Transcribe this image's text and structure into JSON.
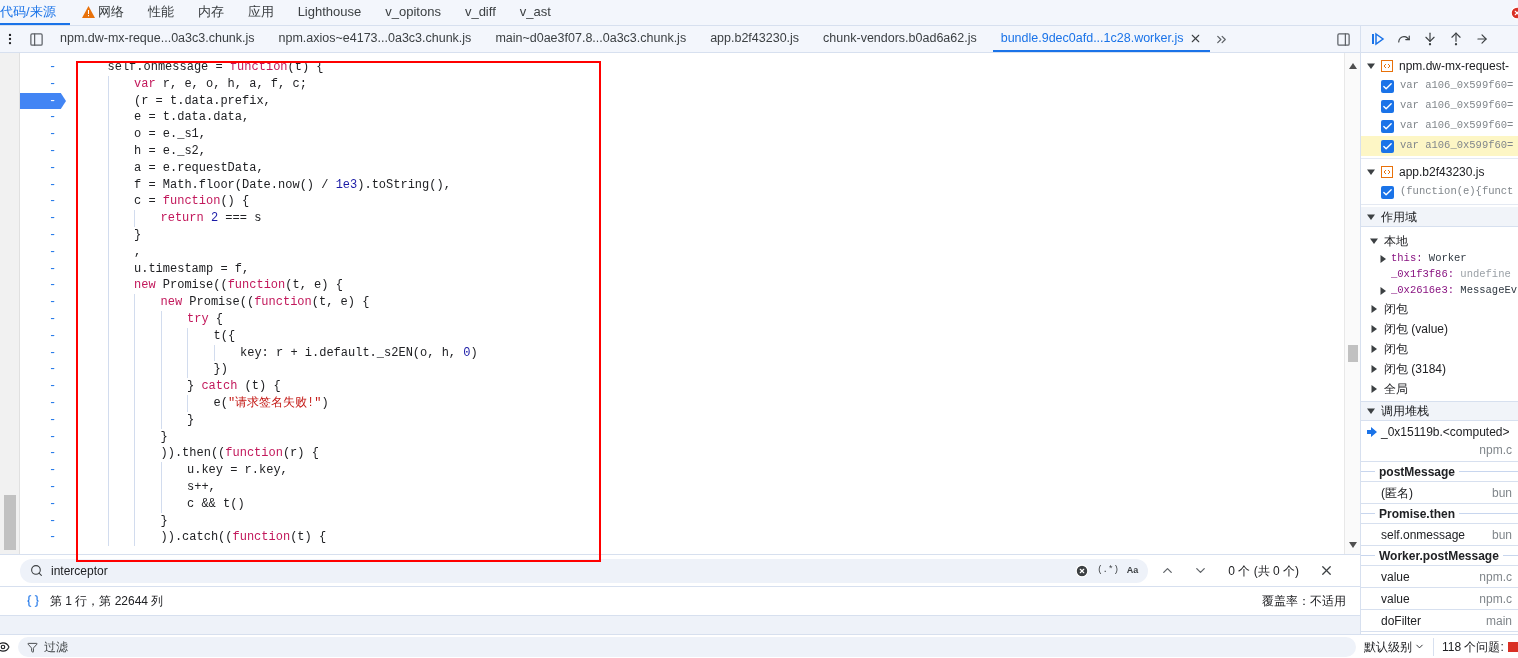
{
  "main_tabs": [
    {
      "label": "代码/来源",
      "selected": true,
      "warning": false
    },
    {
      "label": "网络",
      "selected": false,
      "warning": true
    },
    {
      "label": "性能",
      "selected": false,
      "warning": false
    },
    {
      "label": "内存",
      "selected": false,
      "warning": false
    },
    {
      "label": "应用",
      "selected": false,
      "warning": false
    },
    {
      "label": "Lighthouse",
      "selected": false,
      "warning": false
    },
    {
      "label": "v_opitons",
      "selected": false,
      "warning": false
    },
    {
      "label": "v_diff",
      "selected": false,
      "warning": false
    },
    {
      "label": "v_ast",
      "selected": false,
      "warning": false
    }
  ],
  "file_tabs": [
    {
      "label": "npm.dw-mx-reque...0a3c3.chunk.js",
      "selected": false
    },
    {
      "label": "npm.axios~e4173...0a3c3.chunk.js",
      "selected": false
    },
    {
      "label": "main~d0ae3f07.8...0a3c3.chunk.js",
      "selected": false
    },
    {
      "label": "app.b2f43230.js",
      "selected": false
    },
    {
      "label": "chunk-vendors.b0ad6a62.js",
      "selected": false
    },
    {
      "label": "bundle.9dec0afd...1c28.worker.js",
      "selected": true
    }
  ],
  "code": {
    "lines": [
      {
        "gutter": "-",
        "breakpoint": false,
        "tokens": [
          {
            "t": "self.onmessage = ",
            "kind": "plain"
          },
          {
            "t": "function",
            "kind": "kw"
          },
          {
            "t": "(t) {",
            "kind": "plain"
          }
        ],
        "children": [
          {
            "gutter": "-",
            "breakpoint": false,
            "tokens": [
              {
                "t": "var",
                "kind": "kw"
              },
              {
                "t": " r, e, o, h, a, f, c;",
                "kind": "plain"
              }
            ]
          },
          {
            "gutter": "-",
            "breakpoint": true,
            "tokens": [
              {
                "t": "(r = t.data.prefix,",
                "kind": "plain"
              }
            ]
          },
          {
            "gutter": "-",
            "breakpoint": false,
            "tokens": [
              {
                "t": "e = t.data.data,",
                "kind": "plain"
              }
            ]
          },
          {
            "gutter": "-",
            "breakpoint": false,
            "tokens": [
              {
                "t": "o = e._s1,",
                "kind": "plain"
              }
            ]
          },
          {
            "gutter": "-",
            "breakpoint": false,
            "tokens": [
              {
                "t": "h = e._s2,",
                "kind": "plain"
              }
            ]
          },
          {
            "gutter": "-",
            "breakpoint": false,
            "tokens": [
              {
                "t": "a = e.requestData,",
                "kind": "plain"
              }
            ]
          },
          {
            "gutter": "-",
            "breakpoint": false,
            "tokens": [
              {
                "t": "f = Math.floor(Date.now() / ",
                "kind": "plain"
              },
              {
                "t": "1e3",
                "kind": "num"
              },
              {
                "t": ").toString(),",
                "kind": "plain"
              }
            ]
          },
          {
            "gutter": "-",
            "breakpoint": false,
            "tokens": [
              {
                "t": "c = ",
                "kind": "plain"
              },
              {
                "t": "function",
                "kind": "kw"
              },
              {
                "t": "() {",
                "kind": "plain"
              }
            ],
            "children": [
              {
                "gutter": "-",
                "breakpoint": false,
                "tokens": [
                  {
                    "t": "return",
                    "kind": "kw"
                  },
                  {
                    "t": " 2",
                    "kind": "num"
                  },
                  {
                    "t": " === s",
                    "kind": "plain"
                  }
                ]
              }
            ]
          },
          {
            "gutter": "-",
            "breakpoint": false,
            "tokens": [
              {
                "t": "}",
                "kind": "plain"
              }
            ]
          },
          {
            "gutter": "-",
            "breakpoint": false,
            "tokens": [
              {
                "t": ",",
                "kind": "plain"
              }
            ]
          },
          {
            "gutter": "-",
            "breakpoint": false,
            "tokens": [
              {
                "t": "u.timestamp = f,",
                "kind": "plain"
              }
            ]
          },
          {
            "gutter": "-",
            "breakpoint": false,
            "tokens": [
              {
                "t": "new",
                "kind": "kw"
              },
              {
                "t": " Promise((",
                "kind": "plain"
              },
              {
                "t": "function",
                "kind": "kw"
              },
              {
                "t": "(t, e) {",
                "kind": "plain"
              }
            ],
            "children": [
              {
                "gutter": "-",
                "breakpoint": false,
                "tokens": [
                  {
                    "t": "new",
                    "kind": "kw"
                  },
                  {
                    "t": " Promise((",
                    "kind": "plain"
                  },
                  {
                    "t": "function",
                    "kind": "kw"
                  },
                  {
                    "t": "(t, e) {",
                    "kind": "plain"
                  }
                ],
                "children": [
                  {
                    "gutter": "-",
                    "breakpoint": false,
                    "tokens": [
                      {
                        "t": "try",
                        "kind": "kw"
                      },
                      {
                        "t": " {",
                        "kind": "plain"
                      }
                    ],
                    "children": [
                      {
                        "gutter": "-",
                        "breakpoint": false,
                        "tokens": [
                          {
                            "t": "t({",
                            "kind": "plain"
                          }
                        ],
                        "children": [
                          {
                            "gutter": "-",
                            "breakpoint": false,
                            "tokens": [
                              {
                                "t": "key: r + i.default._s2EN(o, h, ",
                                "kind": "plain"
                              },
                              {
                                "t": "0",
                                "kind": "num"
                              },
                              {
                                "t": ")",
                                "kind": "plain"
                              }
                            ]
                          }
                        ]
                      },
                      {
                        "gutter": "-",
                        "breakpoint": false,
                        "tokens": [
                          {
                            "t": "})",
                            "kind": "plain"
                          }
                        ]
                      }
                    ]
                  },
                  {
                    "gutter": "-",
                    "breakpoint": false,
                    "tokens": [
                      {
                        "t": "} ",
                        "kind": "plain"
                      },
                      {
                        "t": "catch",
                        "kind": "kw"
                      },
                      {
                        "t": " (t) {",
                        "kind": "plain"
                      }
                    ],
                    "children": [
                      {
                        "gutter": "-",
                        "breakpoint": false,
                        "tokens": [
                          {
                            "t": "e(",
                            "kind": "plain"
                          },
                          {
                            "t": "\"请求签名失败!\"",
                            "kind": "str"
                          },
                          {
                            "t": ")",
                            "kind": "plain"
                          }
                        ]
                      }
                    ]
                  },
                  {
                    "gutter": "-",
                    "breakpoint": false,
                    "tokens": [
                      {
                        "t": "}",
                        "kind": "plain"
                      }
                    ]
                  }
                ]
              },
              {
                "gutter": "-",
                "breakpoint": false,
                "tokens": [
                  {
                    "t": "}",
                    "kind": "plain"
                  }
                ]
              },
              {
                "gutter": "-",
                "breakpoint": false,
                "tokens": [
                  {
                    "t": ")).then((",
                    "kind": "plain"
                  },
                  {
                    "t": "function",
                    "kind": "kw"
                  },
                  {
                    "t": "(r) {",
                    "kind": "plain"
                  }
                ],
                "children": [
                  {
                    "gutter": "-",
                    "breakpoint": false,
                    "tokens": [
                      {
                        "t": "u.key = r.key,",
                        "kind": "plain"
                      }
                    ]
                  },
                  {
                    "gutter": "-",
                    "breakpoint": false,
                    "tokens": [
                      {
                        "t": "s++,",
                        "kind": "plain"
                      }
                    ]
                  },
                  {
                    "gutter": "-",
                    "breakpoint": false,
                    "tokens": [
                      {
                        "t": "c && t()",
                        "kind": "plain"
                      }
                    ]
                  }
                ]
              },
              {
                "gutter": "-",
                "breakpoint": false,
                "tokens": [
                  {
                    "t": "}",
                    "kind": "plain"
                  }
                ]
              },
              {
                "gutter": "-",
                "breakpoint": false,
                "tokens": [
                  {
                    "t": ")).catch((",
                    "kind": "plain"
                  },
                  {
                    "t": "function",
                    "kind": "kw"
                  },
                  {
                    "t": "(t) {",
                    "kind": "plain"
                  }
                ]
              }
            ]
          }
        ]
      }
    ]
  },
  "search": {
    "value": "interceptor",
    "regex": "(.*)",
    "match_case": "Aa",
    "result": "0 个 (共 0 个)"
  },
  "status_bar": {
    "position": "第 1 行，第 22644 列",
    "coverage": "覆盖率：不适用"
  },
  "breakpoints": [
    {
      "file": "npm.dw-mx-request-",
      "expanded": true,
      "items": [
        {
          "text": "var a106_0x599f60=",
          "checked": true,
          "selected": false
        },
        {
          "text": "var a106_0x599f60=",
          "checked": true,
          "selected": false
        },
        {
          "text": "var a106_0x599f60=",
          "checked": true,
          "selected": false
        },
        {
          "text": "var a106_0x599f60=",
          "checked": true,
          "selected": true
        }
      ]
    },
    {
      "file": "app.b2f43230.js",
      "expanded": true,
      "items": [
        {
          "text": "(function(e){funct",
          "checked": true,
          "selected": false
        }
      ]
    }
  ],
  "scope": {
    "title": "作用域",
    "expanded": true,
    "groups": [
      {
        "label": "本地",
        "expanded": true,
        "children": [
          {
            "name": "this:",
            "value": "Worker",
            "expandable": true
          },
          {
            "name": "_0x1f3f86:",
            "value": "undefine",
            "expandable": false
          },
          {
            "name": "_0x2616e3:",
            "value": "MessageEv",
            "expandable": true
          }
        ]
      },
      {
        "label": "闭包",
        "expanded": false
      },
      {
        "label": "闭包 (value)",
        "expanded": false
      },
      {
        "label": "闭包",
        "expanded": false
      },
      {
        "label": "闭包 (3184)",
        "expanded": false
      },
      {
        "label": "全局",
        "expanded": false
      }
    ]
  },
  "call_stack": {
    "title": "调用堆栈",
    "expanded": true,
    "frames": [
      {
        "kind": "frame",
        "name": "_0x15119b.<computed>",
        "file": "npm.c",
        "current": true
      },
      {
        "kind": "async",
        "name": "postMessage"
      },
      {
        "kind": "frame",
        "name": "(匿名)",
        "file": "bun",
        "current": false
      },
      {
        "kind": "async",
        "name": "Promise.then"
      },
      {
        "kind": "frame",
        "name": "self.onmessage",
        "file": "bun",
        "current": false
      },
      {
        "kind": "async",
        "name": "Worker.postMessage"
      },
      {
        "kind": "frame",
        "name": "value",
        "file": "npm.c",
        "current": false
      },
      {
        "kind": "frame",
        "name": "value",
        "file": "npm.c",
        "current": false
      },
      {
        "kind": "frame",
        "name": "doFilter",
        "file": "main",
        "current": false
      }
    ]
  },
  "console": {
    "filter_placeholder": "过滤",
    "level": "默认级别",
    "issues": "118 个问题:"
  }
}
